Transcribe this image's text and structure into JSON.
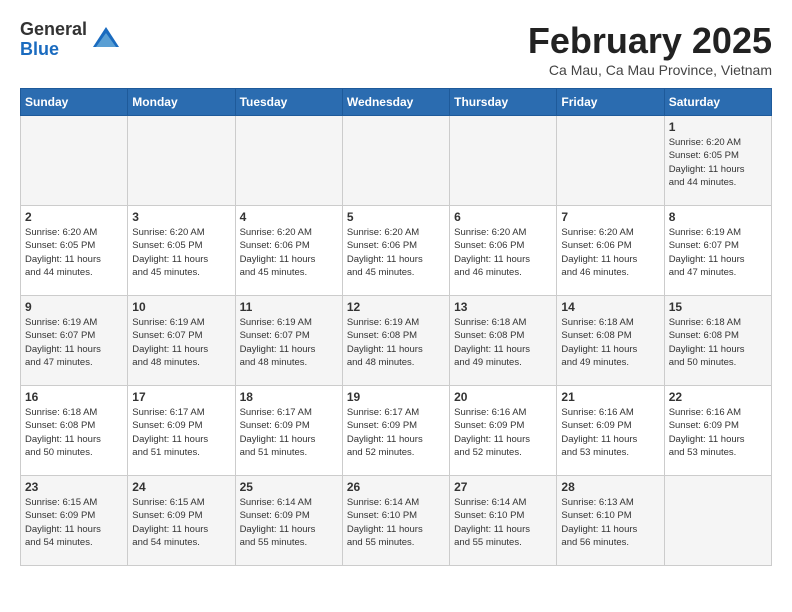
{
  "header": {
    "logo": {
      "general": "General",
      "blue": "Blue"
    },
    "title": "February 2025",
    "location": "Ca Mau, Ca Mau Province, Vietnam"
  },
  "weekdays": [
    "Sunday",
    "Monday",
    "Tuesday",
    "Wednesday",
    "Thursday",
    "Friday",
    "Saturday"
  ],
  "weeks": [
    [
      {
        "day": "",
        "info": ""
      },
      {
        "day": "",
        "info": ""
      },
      {
        "day": "",
        "info": ""
      },
      {
        "day": "",
        "info": ""
      },
      {
        "day": "",
        "info": ""
      },
      {
        "day": "",
        "info": ""
      },
      {
        "day": "1",
        "info": "Sunrise: 6:20 AM\nSunset: 6:05 PM\nDaylight: 11 hours\nand 44 minutes."
      }
    ],
    [
      {
        "day": "2",
        "info": "Sunrise: 6:20 AM\nSunset: 6:05 PM\nDaylight: 11 hours\nand 44 minutes."
      },
      {
        "day": "3",
        "info": "Sunrise: 6:20 AM\nSunset: 6:05 PM\nDaylight: 11 hours\nand 45 minutes."
      },
      {
        "day": "4",
        "info": "Sunrise: 6:20 AM\nSunset: 6:06 PM\nDaylight: 11 hours\nand 45 minutes."
      },
      {
        "day": "5",
        "info": "Sunrise: 6:20 AM\nSunset: 6:06 PM\nDaylight: 11 hours\nand 45 minutes."
      },
      {
        "day": "6",
        "info": "Sunrise: 6:20 AM\nSunset: 6:06 PM\nDaylight: 11 hours\nand 46 minutes."
      },
      {
        "day": "7",
        "info": "Sunrise: 6:20 AM\nSunset: 6:06 PM\nDaylight: 11 hours\nand 46 minutes."
      },
      {
        "day": "8",
        "info": "Sunrise: 6:19 AM\nSunset: 6:07 PM\nDaylight: 11 hours\nand 47 minutes."
      }
    ],
    [
      {
        "day": "9",
        "info": "Sunrise: 6:19 AM\nSunset: 6:07 PM\nDaylight: 11 hours\nand 47 minutes."
      },
      {
        "day": "10",
        "info": "Sunrise: 6:19 AM\nSunset: 6:07 PM\nDaylight: 11 hours\nand 48 minutes."
      },
      {
        "day": "11",
        "info": "Sunrise: 6:19 AM\nSunset: 6:07 PM\nDaylight: 11 hours\nand 48 minutes."
      },
      {
        "day": "12",
        "info": "Sunrise: 6:19 AM\nSunset: 6:08 PM\nDaylight: 11 hours\nand 48 minutes."
      },
      {
        "day": "13",
        "info": "Sunrise: 6:18 AM\nSunset: 6:08 PM\nDaylight: 11 hours\nand 49 minutes."
      },
      {
        "day": "14",
        "info": "Sunrise: 6:18 AM\nSunset: 6:08 PM\nDaylight: 11 hours\nand 49 minutes."
      },
      {
        "day": "15",
        "info": "Sunrise: 6:18 AM\nSunset: 6:08 PM\nDaylight: 11 hours\nand 50 minutes."
      }
    ],
    [
      {
        "day": "16",
        "info": "Sunrise: 6:18 AM\nSunset: 6:08 PM\nDaylight: 11 hours\nand 50 minutes."
      },
      {
        "day": "17",
        "info": "Sunrise: 6:17 AM\nSunset: 6:09 PM\nDaylight: 11 hours\nand 51 minutes."
      },
      {
        "day": "18",
        "info": "Sunrise: 6:17 AM\nSunset: 6:09 PM\nDaylight: 11 hours\nand 51 minutes."
      },
      {
        "day": "19",
        "info": "Sunrise: 6:17 AM\nSunset: 6:09 PM\nDaylight: 11 hours\nand 52 minutes."
      },
      {
        "day": "20",
        "info": "Sunrise: 6:16 AM\nSunset: 6:09 PM\nDaylight: 11 hours\nand 52 minutes."
      },
      {
        "day": "21",
        "info": "Sunrise: 6:16 AM\nSunset: 6:09 PM\nDaylight: 11 hours\nand 53 minutes."
      },
      {
        "day": "22",
        "info": "Sunrise: 6:16 AM\nSunset: 6:09 PM\nDaylight: 11 hours\nand 53 minutes."
      }
    ],
    [
      {
        "day": "23",
        "info": "Sunrise: 6:15 AM\nSunset: 6:09 PM\nDaylight: 11 hours\nand 54 minutes."
      },
      {
        "day": "24",
        "info": "Sunrise: 6:15 AM\nSunset: 6:09 PM\nDaylight: 11 hours\nand 54 minutes."
      },
      {
        "day": "25",
        "info": "Sunrise: 6:14 AM\nSunset: 6:09 PM\nDaylight: 11 hours\nand 55 minutes."
      },
      {
        "day": "26",
        "info": "Sunrise: 6:14 AM\nSunset: 6:10 PM\nDaylight: 11 hours\nand 55 minutes."
      },
      {
        "day": "27",
        "info": "Sunrise: 6:14 AM\nSunset: 6:10 PM\nDaylight: 11 hours\nand 55 minutes."
      },
      {
        "day": "28",
        "info": "Sunrise: 6:13 AM\nSunset: 6:10 PM\nDaylight: 11 hours\nand 56 minutes."
      },
      {
        "day": "",
        "info": ""
      }
    ]
  ]
}
